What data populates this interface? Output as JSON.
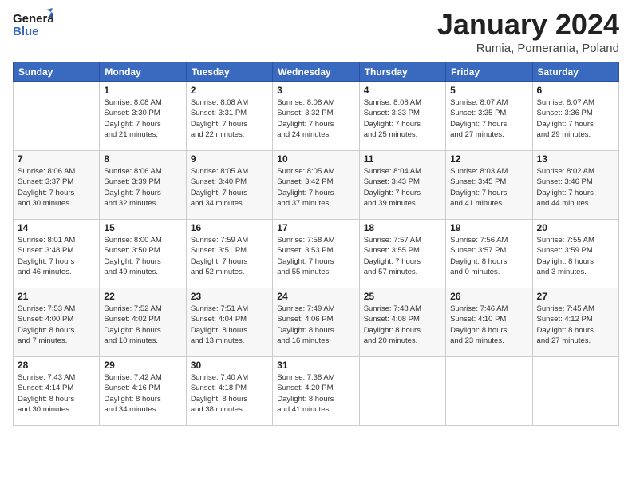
{
  "header": {
    "logo_general": "General",
    "logo_blue": "Blue",
    "month_title": "January 2024",
    "subtitle": "Rumia, Pomerania, Poland"
  },
  "weekdays": [
    "Sunday",
    "Monday",
    "Tuesday",
    "Wednesday",
    "Thursday",
    "Friday",
    "Saturday"
  ],
  "weeks": [
    [
      {
        "day": "",
        "info": ""
      },
      {
        "day": "1",
        "info": "Sunrise: 8:08 AM\nSunset: 3:30 PM\nDaylight: 7 hours\nand 21 minutes."
      },
      {
        "day": "2",
        "info": "Sunrise: 8:08 AM\nSunset: 3:31 PM\nDaylight: 7 hours\nand 22 minutes."
      },
      {
        "day": "3",
        "info": "Sunrise: 8:08 AM\nSunset: 3:32 PM\nDaylight: 7 hours\nand 24 minutes."
      },
      {
        "day": "4",
        "info": "Sunrise: 8:08 AM\nSunset: 3:33 PM\nDaylight: 7 hours\nand 25 minutes."
      },
      {
        "day": "5",
        "info": "Sunrise: 8:07 AM\nSunset: 3:35 PM\nDaylight: 7 hours\nand 27 minutes."
      },
      {
        "day": "6",
        "info": "Sunrise: 8:07 AM\nSunset: 3:36 PM\nDaylight: 7 hours\nand 29 minutes."
      }
    ],
    [
      {
        "day": "7",
        "info": ""
      },
      {
        "day": "8",
        "info": "Sunrise: 8:06 AM\nSunset: 3:39 PM\nDaylight: 7 hours\nand 32 minutes."
      },
      {
        "day": "9",
        "info": "Sunrise: 8:05 AM\nSunset: 3:40 PM\nDaylight: 7 hours\nand 34 minutes."
      },
      {
        "day": "10",
        "info": "Sunrise: 8:05 AM\nSunset: 3:42 PM\nDaylight: 7 hours\nand 37 minutes."
      },
      {
        "day": "11",
        "info": "Sunrise: 8:04 AM\nSunset: 3:43 PM\nDaylight: 7 hours\nand 39 minutes."
      },
      {
        "day": "12",
        "info": "Sunrise: 8:03 AM\nSunset: 3:45 PM\nDaylight: 7 hours\nand 41 minutes."
      },
      {
        "day": "13",
        "info": "Sunrise: 8:02 AM\nSunset: 3:46 PM\nDaylight: 7 hours\nand 44 minutes."
      }
    ],
    [
      {
        "day": "14",
        "info": "Sunrise: 8:01 AM\nSunset: 3:48 PM\nDaylight: 7 hours\nand 46 minutes."
      },
      {
        "day": "15",
        "info": "Sunrise: 8:00 AM\nSunset: 3:50 PM\nDaylight: 7 hours\nand 49 minutes."
      },
      {
        "day": "16",
        "info": "Sunrise: 7:59 AM\nSunset: 3:51 PM\nDaylight: 7 hours\nand 52 minutes."
      },
      {
        "day": "17",
        "info": "Sunrise: 7:58 AM\nSunset: 3:53 PM\nDaylight: 7 hours\nand 55 minutes."
      },
      {
        "day": "18",
        "info": "Sunrise: 7:57 AM\nSunset: 3:55 PM\nDaylight: 7 hours\nand 57 minutes."
      },
      {
        "day": "19",
        "info": "Sunrise: 7:56 AM\nSunset: 3:57 PM\nDaylight: 8 hours\nand 0 minutes."
      },
      {
        "day": "20",
        "info": "Sunrise: 7:55 AM\nSunset: 3:59 PM\nDaylight: 8 hours\nand 3 minutes."
      }
    ],
    [
      {
        "day": "21",
        "info": "Sunrise: 7:53 AM\nSunset: 4:00 PM\nDaylight: 8 hours\nand 7 minutes."
      },
      {
        "day": "22",
        "info": "Sunrise: 7:52 AM\nSunset: 4:02 PM\nDaylight: 8 hours\nand 10 minutes."
      },
      {
        "day": "23",
        "info": "Sunrise: 7:51 AM\nSunset: 4:04 PM\nDaylight: 8 hours\nand 13 minutes."
      },
      {
        "day": "24",
        "info": "Sunrise: 7:49 AM\nSunset: 4:06 PM\nDaylight: 8 hours\nand 16 minutes."
      },
      {
        "day": "25",
        "info": "Sunrise: 7:48 AM\nSunset: 4:08 PM\nDaylight: 8 hours\nand 20 minutes."
      },
      {
        "day": "26",
        "info": "Sunrise: 7:46 AM\nSunset: 4:10 PM\nDaylight: 8 hours\nand 23 minutes."
      },
      {
        "day": "27",
        "info": "Sunrise: 7:45 AM\nSunset: 4:12 PM\nDaylight: 8 hours\nand 27 minutes."
      }
    ],
    [
      {
        "day": "28",
        "info": "Sunrise: 7:43 AM\nSunset: 4:14 PM\nDaylight: 8 hours\nand 30 minutes."
      },
      {
        "day": "29",
        "info": "Sunrise: 7:42 AM\nSunset: 4:16 PM\nDaylight: 8 hours\nand 34 minutes."
      },
      {
        "day": "30",
        "info": "Sunrise: 7:40 AM\nSunset: 4:18 PM\nDaylight: 8 hours\nand 38 minutes."
      },
      {
        "day": "31",
        "info": "Sunrise: 7:38 AM\nSunset: 4:20 PM\nDaylight: 8 hours\nand 41 minutes."
      },
      {
        "day": "",
        "info": ""
      },
      {
        "day": "",
        "info": ""
      },
      {
        "day": "",
        "info": ""
      }
    ]
  ],
  "week1_sun_info": "Sunrise: 8:06 AM\nSunset: 3:37 PM\nDaylight: 7 hours\nand 30 minutes."
}
